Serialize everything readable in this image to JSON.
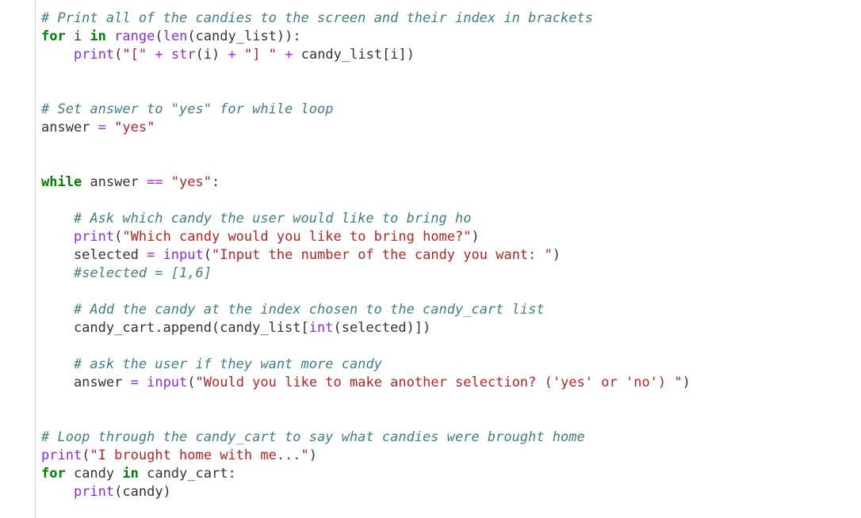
{
  "colors": {
    "background": "#ffffff",
    "gutter_border": "#d6d6d6",
    "comment": "#3f7f7f",
    "keyword": "#008000",
    "builtin": "#8a2be2",
    "string": "#ba2121",
    "operator": "#aa22ff",
    "plain": "#333333"
  },
  "code_lines": [
    [
      {
        "t": "comment",
        "v": "# Print all of the candies to the screen and their index in brackets"
      }
    ],
    [
      {
        "t": "keyword",
        "v": "for"
      },
      {
        "t": "plain",
        "v": " i "
      },
      {
        "t": "keyword",
        "v": "in"
      },
      {
        "t": "plain",
        "v": " "
      },
      {
        "t": "builtin",
        "v": "range"
      },
      {
        "t": "plain",
        "v": "("
      },
      {
        "t": "builtin",
        "v": "len"
      },
      {
        "t": "plain",
        "v": "(candy_list)):"
      }
    ],
    [
      {
        "t": "plain",
        "v": "    "
      },
      {
        "t": "builtin",
        "v": "print"
      },
      {
        "t": "plain",
        "v": "("
      },
      {
        "t": "string",
        "v": "\"[\""
      },
      {
        "t": "plain",
        "v": " "
      },
      {
        "t": "op",
        "v": "+"
      },
      {
        "t": "plain",
        "v": " "
      },
      {
        "t": "builtin",
        "v": "str"
      },
      {
        "t": "plain",
        "v": "(i) "
      },
      {
        "t": "op",
        "v": "+"
      },
      {
        "t": "plain",
        "v": " "
      },
      {
        "t": "string",
        "v": "\"] \""
      },
      {
        "t": "plain",
        "v": " "
      },
      {
        "t": "op",
        "v": "+"
      },
      {
        "t": "plain",
        "v": " candy_list[i])"
      }
    ],
    [],
    [],
    [
      {
        "t": "comment",
        "v": "# Set answer to \"yes\" for while loop"
      }
    ],
    [
      {
        "t": "plain",
        "v": "answer "
      },
      {
        "t": "op",
        "v": "="
      },
      {
        "t": "plain",
        "v": " "
      },
      {
        "t": "string",
        "v": "\"yes\""
      }
    ],
    [],
    [],
    [
      {
        "t": "keyword",
        "v": "while"
      },
      {
        "t": "plain",
        "v": " answer "
      },
      {
        "t": "op",
        "v": "=="
      },
      {
        "t": "plain",
        "v": " "
      },
      {
        "t": "string",
        "v": "\"yes\""
      },
      {
        "t": "plain",
        "v": ":"
      }
    ],
    [],
    [
      {
        "t": "plain",
        "v": "    "
      },
      {
        "t": "comment",
        "v": "# Ask which candy the user would like to bring ho"
      }
    ],
    [
      {
        "t": "plain",
        "v": "    "
      },
      {
        "t": "builtin",
        "v": "print"
      },
      {
        "t": "plain",
        "v": "("
      },
      {
        "t": "string",
        "v": "\"Which candy would you like to bring home?\""
      },
      {
        "t": "plain",
        "v": ")"
      }
    ],
    [
      {
        "t": "plain",
        "v": "    selected "
      },
      {
        "t": "op",
        "v": "="
      },
      {
        "t": "plain",
        "v": " "
      },
      {
        "t": "builtin",
        "v": "input"
      },
      {
        "t": "plain",
        "v": "("
      },
      {
        "t": "string",
        "v": "\"Input the number of the candy you want: \""
      },
      {
        "t": "plain",
        "v": ")"
      }
    ],
    [
      {
        "t": "plain",
        "v": "    "
      },
      {
        "t": "comment",
        "v": "#selected = [1,6]"
      }
    ],
    [],
    [
      {
        "t": "plain",
        "v": "    "
      },
      {
        "t": "comment",
        "v": "# Add the candy at the index chosen to the candy_cart list"
      }
    ],
    [
      {
        "t": "plain",
        "v": "    candy_cart.append(candy_list["
      },
      {
        "t": "builtin",
        "v": "int"
      },
      {
        "t": "plain",
        "v": "(selected)])"
      }
    ],
    [],
    [
      {
        "t": "plain",
        "v": "    "
      },
      {
        "t": "comment",
        "v": "# ask the user if they want more candy"
      }
    ],
    [
      {
        "t": "plain",
        "v": "    answer "
      },
      {
        "t": "op",
        "v": "="
      },
      {
        "t": "plain",
        "v": " "
      },
      {
        "t": "builtin",
        "v": "input"
      },
      {
        "t": "plain",
        "v": "("
      },
      {
        "t": "string",
        "v": "\"Would you like to make another selection? ('yes' or 'no') \""
      },
      {
        "t": "plain",
        "v": ")"
      }
    ],
    [],
    [],
    [
      {
        "t": "comment",
        "v": "# Loop through the candy_cart to say what candies were brought home"
      }
    ],
    [
      {
        "t": "builtin",
        "v": "print"
      },
      {
        "t": "plain",
        "v": "("
      },
      {
        "t": "string",
        "v": "\"I brought home with me...\""
      },
      {
        "t": "plain",
        "v": ")"
      }
    ],
    [
      {
        "t": "keyword",
        "v": "for"
      },
      {
        "t": "plain",
        "v": " candy "
      },
      {
        "t": "keyword",
        "v": "in"
      },
      {
        "t": "plain",
        "v": " candy_cart:"
      }
    ],
    [
      {
        "t": "plain",
        "v": "    "
      },
      {
        "t": "builtin",
        "v": "print"
      },
      {
        "t": "plain",
        "v": "(candy)"
      }
    ]
  ]
}
